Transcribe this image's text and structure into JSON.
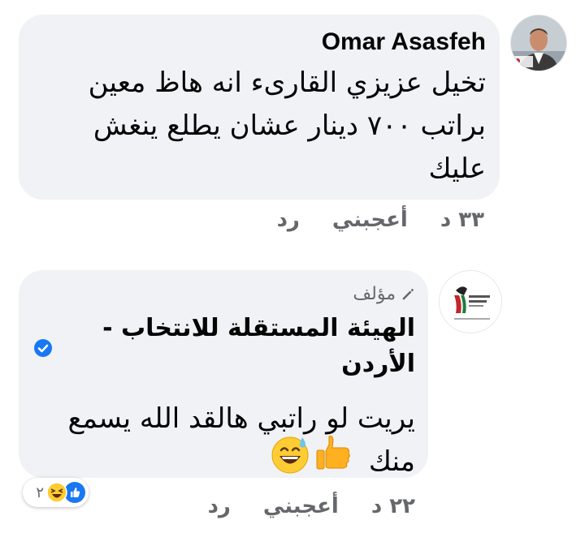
{
  "comments": [
    {
      "author": "Omar Asasfeh",
      "avatar_icon": "profile-photo-icon",
      "text": "تخيل عزيزي القارىء انه هاظ معين\nبراتب ٧٠٠ دينار عشان يطلع ينغش\nعليك",
      "time": "٣٣ د",
      "like_label": "أعجبني",
      "reply_label": "رد"
    },
    {
      "badge_icon": "pencil-icon",
      "badge_label": "مؤلف",
      "author_line1": "الهيئة المستقلة للانتخاب -",
      "author_line2": "الأردن",
      "verified_icon": "verified-check-icon",
      "avatar_icon": "page-logo-icon",
      "text": "يريت لو راتبي هالقد الله يسمع\nمنك",
      "emoji_icons": [
        "sweat-smile-emoji-icon",
        "thumbs-up-emoji-icon"
      ],
      "time": "٢٢ د",
      "like_label": "أعجبني",
      "reply_label": "رد",
      "reaction_icons": [
        "like-reaction-icon",
        "haha-reaction-icon"
      ],
      "reaction_count": "٢"
    }
  ],
  "colors": {
    "bubble": "#f0f2f5",
    "secondary_text": "#65676b",
    "verified_blue": "#1877f2",
    "like_blue": "#1877f2",
    "emoji_yellow": "#ffcc33"
  }
}
